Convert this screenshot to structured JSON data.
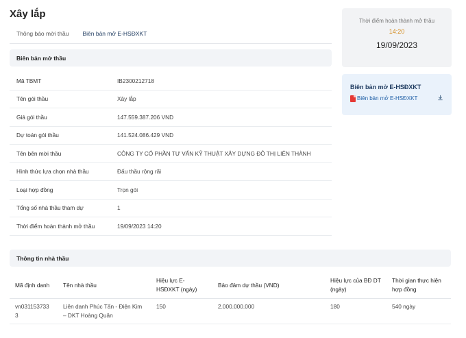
{
  "page": {
    "title": "Xây lắp"
  },
  "tabs": [
    {
      "label": "Thông báo mời thầu"
    },
    {
      "label": "Biên bản mở E-HSĐXKT"
    }
  ],
  "info_section": {
    "header": "Biên bản mở thầu",
    "rows": [
      {
        "label": "Mã TBMT",
        "value": "IB2300212718"
      },
      {
        "label": "Tên gói thầu",
        "value": "Xây lắp"
      },
      {
        "label": "Giá gói thầu",
        "value": "147.559.387.206 VND"
      },
      {
        "label": "Dự toán gói thầu",
        "value": "141.524.086.429 VND"
      },
      {
        "label": "Tên bên mời thầu",
        "value": "CÔNG TY CỔ PHẦN TƯ VẤN KỸ THUẬT XÂY DỰNG ĐÔ THỊ LIÊN THÀNH"
      },
      {
        "label": "Hình thức lựa chọn nhà thầu",
        "value": "Đấu thầu rộng rãi"
      },
      {
        "label": "Loại hợp đồng",
        "value": "Trọn gói"
      },
      {
        "label": "Tổng số nhà thầu tham dự",
        "value": "1"
      },
      {
        "label": "Thời điểm hoàn thành mở thầu",
        "value": "19/09/2023 14:20"
      }
    ]
  },
  "time_card": {
    "label": "Thời điểm hoàn thành mở thầu",
    "time": "14:20",
    "date": "19/09/2023"
  },
  "doc_card": {
    "title": "Biên bản mở E-HSĐXKT",
    "link_label": "Biên bản mở E-HSĐXKT",
    "icons": {
      "file": "pdf-icon",
      "action": "download-icon"
    },
    "pdf_color": "#e53935"
  },
  "contractor_section": {
    "header": "Thông tin nhà thầu",
    "columns": [
      "Mã định danh",
      "Tên nhà thầu",
      "Hiệu lực E-HSĐXKT (ngày)",
      "Bảo đảm dự thầu (VND)",
      "Hiệu lực của BĐ DT (ngày)",
      "Thời gian thực hiện hợp đồng"
    ],
    "rows": [
      {
        "id": "vn0311537333",
        "name": "Liên danh Phúc Tấn - Điện Kim – DKT Hoàng Quân",
        "validity": "150",
        "guarantee": "2.000.000.000",
        "guarantee_validity": "180",
        "duration": "540 ngày"
      }
    ]
  }
}
